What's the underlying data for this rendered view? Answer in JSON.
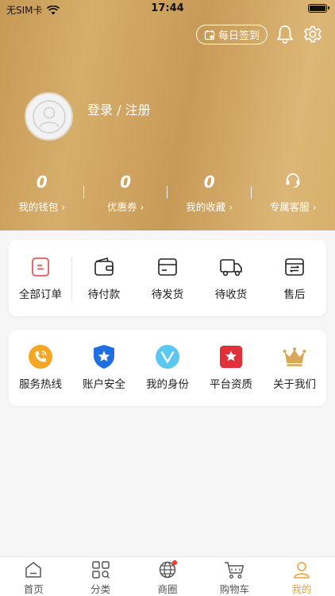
{
  "status_bar": {
    "carrier": "无SIM卡",
    "time": "17:44"
  },
  "header": {
    "checkin_label": "每日签到",
    "login_label": "登录 / 注册",
    "stats": [
      {
        "value": "0",
        "label": "我的钱包 ›"
      },
      {
        "value": "0",
        "label": "优惠券 ›"
      },
      {
        "value": "0",
        "label": "我的收藏 ›"
      },
      {
        "value": "",
        "label": "专属客服 ›"
      }
    ]
  },
  "orders": [
    {
      "label": "全部订单",
      "icon": "all-orders-icon"
    },
    {
      "label": "待付款",
      "icon": "wallet-icon"
    },
    {
      "label": "待发货",
      "icon": "box-icon"
    },
    {
      "label": "待收货",
      "icon": "truck-icon"
    },
    {
      "label": "售后",
      "icon": "after-sales-icon"
    }
  ],
  "services": [
    {
      "label": "服务热线",
      "icon": "phone-icon"
    },
    {
      "label": "账户安全",
      "icon": "shield-star-icon"
    },
    {
      "label": "我的身份",
      "icon": "vip-v-icon"
    },
    {
      "label": "平台资质",
      "icon": "certificate-icon"
    },
    {
      "label": "关于我们",
      "icon": "crown-icon"
    }
  ],
  "tabbar": [
    {
      "label": "首页",
      "icon": "home-icon"
    },
    {
      "label": "分类",
      "icon": "category-icon"
    },
    {
      "label": "商圈",
      "icon": "globe-icon"
    },
    {
      "label": "购物车",
      "icon": "cart-icon"
    },
    {
      "label": "我的",
      "icon": "user-icon",
      "active": true
    }
  ],
  "colors": {
    "accent": "#e8a53a",
    "header_gold": "#d2a664",
    "badge_red": "#ff3b1d"
  }
}
